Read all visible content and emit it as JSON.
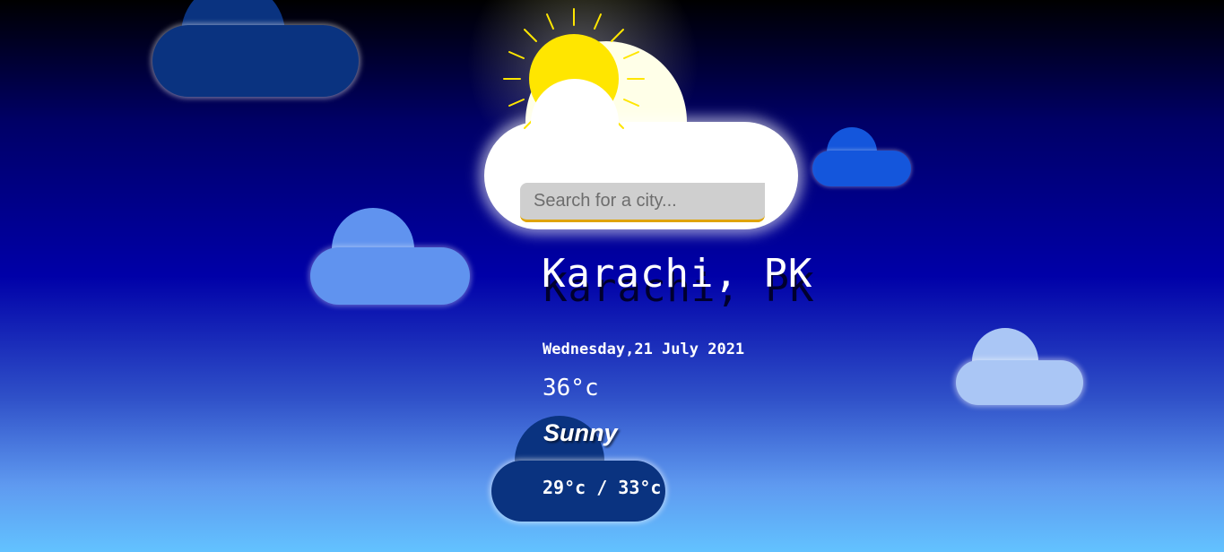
{
  "search": {
    "placeholder": "Search for a city..."
  },
  "weather": {
    "city": "Karachi, PK",
    "date": "Wednesday,21 July 2021",
    "temperature": "36°c",
    "condition": "Sunny",
    "hi_low": "29°c / 33°c"
  },
  "icons": {
    "weather_icon": "sun-behind-cloud-icon"
  },
  "colors": {
    "sun": "#ffe600",
    "search_underline": "#e0a400",
    "background_top": "#000000",
    "background_bottom": "#62c2ff"
  }
}
